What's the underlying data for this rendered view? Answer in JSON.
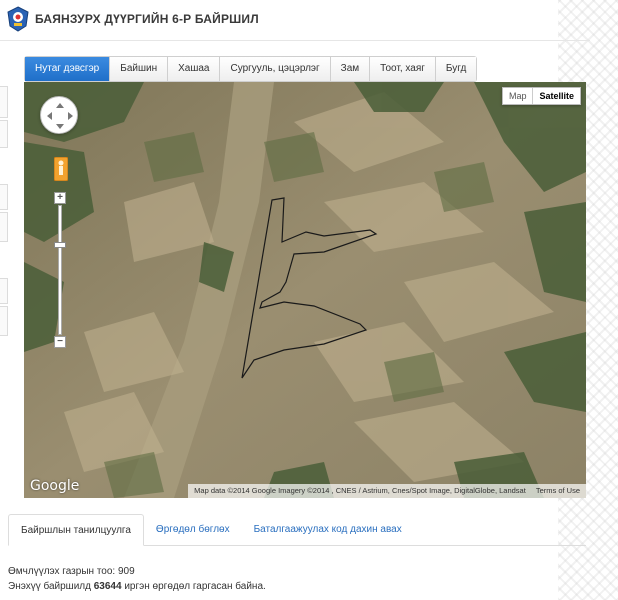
{
  "header": {
    "title": "БАЯНЗУРХ ДҮҮРГИЙН 6-Р БАЙРШИЛ"
  },
  "tabs": [
    {
      "label": "Нутаг дэвсгэр",
      "active": true
    },
    {
      "label": "Байшин",
      "active": false
    },
    {
      "label": "Хашаа",
      "active": false
    },
    {
      "label": "Сургууль, цэцэрлэг",
      "active": false
    },
    {
      "label": "Зам",
      "active": false
    },
    {
      "label": "Тоот, хаяг",
      "active": false
    },
    {
      "label": "Бугд",
      "active": false
    }
  ],
  "map": {
    "type_map": "Map",
    "type_satellite": "Satellite",
    "selected_type": "Satellite",
    "logo": "Google",
    "attribution": "Map data ©2014 Google Imagery ©2014 , CNES / Astrium, Cnes/Spot Image, DigitalGlobe, Landsat",
    "terms": "Terms of Use",
    "icons": [
      "pan-control-icon",
      "pegman-icon",
      "zoom-in-icon",
      "zoom-out-icon"
    ]
  },
  "bottom_tabs": [
    {
      "label": "Байршлын танилцуулга",
      "active": true
    },
    {
      "label": "Өргөдөл бөглөх",
      "active": false
    },
    {
      "label": "Баталгаажуулах код дахин авах",
      "active": false
    }
  ],
  "info": {
    "land_count_label": "Өмчлүүлэх газрын тоо:",
    "land_count_value": "909",
    "applications_prefix": "Энэхүү байршилд",
    "applications_value": "63644",
    "applications_suffix": "иргэн өргөдөл гаргасан байна."
  },
  "colors": {
    "accent": "#1f6fc9",
    "link": "#2a6fbf"
  }
}
